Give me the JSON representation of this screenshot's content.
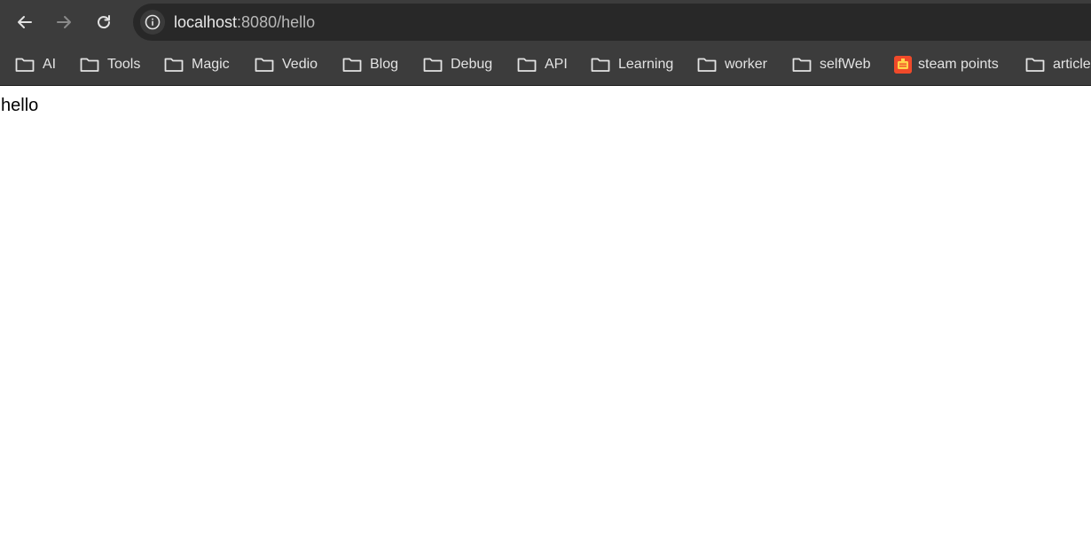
{
  "omnibox": {
    "url_host": "localhost",
    "url_rest": ":8080/hello"
  },
  "bookmarks": [
    {
      "label": "AI",
      "icon": "folder-icon"
    },
    {
      "label": "Tools",
      "icon": "folder-icon"
    },
    {
      "label": "Magic",
      "icon": "folder-icon"
    },
    {
      "label": "Vedio",
      "icon": "folder-icon"
    },
    {
      "label": "Blog",
      "icon": "folder-icon"
    },
    {
      "label": "Debug",
      "icon": "folder-icon"
    },
    {
      "label": "API",
      "icon": "folder-icon"
    },
    {
      "label": "Learning",
      "icon": "folder-icon"
    },
    {
      "label": "worker",
      "icon": "folder-icon"
    },
    {
      "label": "selfWeb",
      "icon": "folder-icon"
    },
    {
      "label": "steam points",
      "icon": "steam-points-favicon"
    },
    {
      "label": "article",
      "icon": "folder-icon"
    }
  ],
  "page": {
    "text": "hello"
  },
  "colors": {
    "chrome_bg": "#3c3c3c",
    "omnibox_bg": "#282828",
    "favicon": "#f04a2a"
  }
}
